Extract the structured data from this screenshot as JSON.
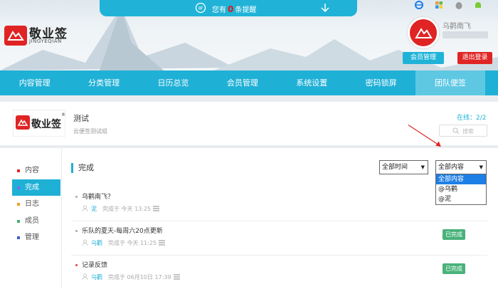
{
  "notice": {
    "prefix": "您有",
    "count": "0",
    "suffix": "条提醒"
  },
  "brand": {
    "name": "敬业签",
    "sub": "JINGYEQIAN"
  },
  "user": {
    "name": "乌鹳南飞",
    "member_btn": "会员管理",
    "logout_btn": "退出登录"
  },
  "nav": [
    "内容管理",
    "分类管理",
    "日历总览",
    "会员管理",
    "系统设置",
    "密码锁屏",
    "团队便签"
  ],
  "team": {
    "logo_text": "敬业签",
    "reg": "®",
    "title": "测试",
    "desc": "云便签测试组",
    "online_label": "在线：",
    "online_value": "2/2",
    "search_label": "搜索"
  },
  "sidebar": [
    {
      "label": "内容",
      "color": "#e02424"
    },
    {
      "label": "完成",
      "color": "#7b68ee"
    },
    {
      "label": "日志",
      "color": "#f0a020"
    },
    {
      "label": "成员",
      "color": "#3cb371"
    },
    {
      "label": "管理",
      "color": "#3a5fcd"
    }
  ],
  "section_title": "完成",
  "filters": {
    "time": "全部时间",
    "content": "全部内容",
    "content_options": [
      "全部内容",
      "@乌鹳",
      "@泥"
    ]
  },
  "items": [
    {
      "title": "乌鹳南飞？",
      "user": "泥",
      "time": "完成于 今天 13:25",
      "badge": "",
      "red": false
    },
    {
      "title": "乐队的夏天-每周六20点更新",
      "user": "乌鹳",
      "time": "完成于 今天 11:25",
      "badge": "已完成",
      "red": false
    },
    {
      "title": "记录反馈",
      "user": "乌鹳",
      "time": "完成于 06月10日 17:39",
      "badge": "已完成",
      "red": true
    }
  ]
}
